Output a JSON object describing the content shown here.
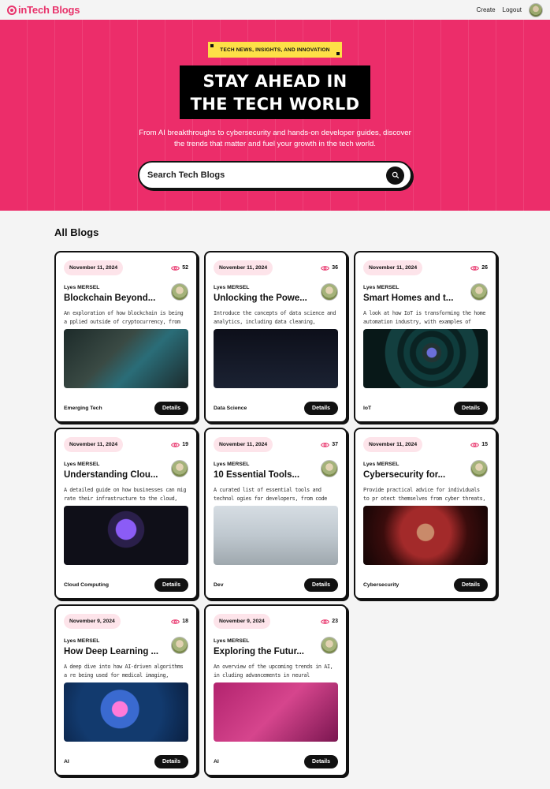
{
  "navbar": {
    "brand": "inTech Blogs",
    "links": [
      "Create",
      "Logout"
    ]
  },
  "hero": {
    "tag": "TECH NEWS, INSIGHTS, AND INNOVATION",
    "title_line1": "STAY AHEAD IN",
    "title_line2": "THE TECH WORLD",
    "description": "From AI breakthroughs to cybersecurity and hands-on developer guides, discover the trends that matter and fuel your growth in the tech world.",
    "search_placeholder": "Search Tech Blogs"
  },
  "section": {
    "title": "All Blogs"
  },
  "details_label": "Details",
  "colors": {
    "accent": "#ec2d6a",
    "tag": "#fde047",
    "dark": "#111111",
    "pill": "#fde4ea"
  },
  "posts": [
    {
      "date": "November 11, 2024",
      "views": "52",
      "author": "Lyes MERSEL",
      "title": "Blockchain Beyond...",
      "description": "An exploration of how blockchain is being a pplied outside of cryptocurrency, from su...",
      "category": "Emerging Tech",
      "image": "img-blockchain"
    },
    {
      "date": "November 11, 2024",
      "views": "36",
      "author": "Lyes MERSEL",
      "title": "Unlocking the Powe...",
      "description": "Introduce the concepts of data science and analytics, including data cleaning, visualiz...",
      "category": "Data Science",
      "image": "img-data"
    },
    {
      "date": "November 11, 2024",
      "views": "26",
      "author": "Lyes MERSEL",
      "title": "Smart Homes and t...",
      "description": "A look at how IoT is transforming the home automation industry, with examples of sm...",
      "category": "IoT",
      "image": "img-iot"
    },
    {
      "date": "November 11, 2024",
      "views": "19",
      "author": "Lyes MERSEL",
      "title": "Understanding Clou...",
      "description": "A detailed guide on how businesses can mig rate their infrastructure to the cloud, cove...",
      "category": "Cloud Computing",
      "image": "img-cloud"
    },
    {
      "date": "November 11, 2024",
      "views": "37",
      "author": "Lyes MERSEL",
      "title": "10 Essential Tools...",
      "description": "A curated list of essential tools and technol ogies for developers, from code editors to...",
      "category": "Dev",
      "image": "img-dev"
    },
    {
      "date": "November 11, 2024",
      "views": "15",
      "author": "Lyes MERSEL",
      "title": "Cybersecurity for...",
      "description": "Provide practical advice for individuals to pr otect themselves from cyber threats, such...",
      "category": "Cybersecurity",
      "image": "img-cyber"
    },
    {
      "date": "November 9, 2024",
      "views": "18",
      "author": "Lyes MERSEL",
      "title": "How Deep Learning ...",
      "description": "A deep dive into how AI-driven algorithms a re being used for medical imaging, diagno...",
      "category": "AI",
      "image": "img-ai-deep"
    },
    {
      "date": "November 9, 2024",
      "views": "23",
      "author": "Lyes MERSEL",
      "title": "Exploring the Futur...",
      "description": "An overview of the upcoming trends in AI, in cluding advancements in neural networks,...",
      "category": "AI",
      "image": "img-ai-future"
    }
  ]
}
